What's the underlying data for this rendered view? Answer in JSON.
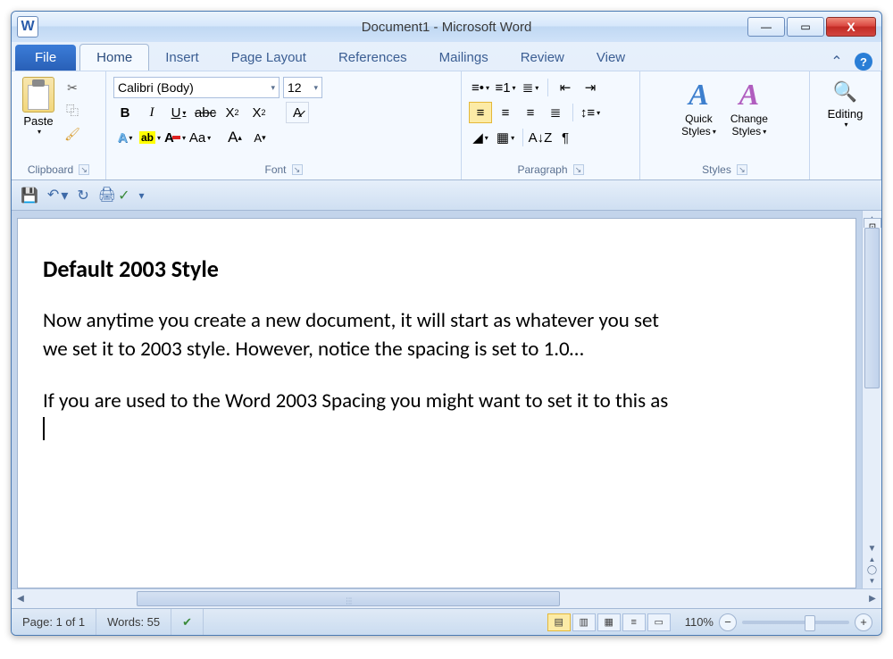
{
  "window": {
    "title": "Document1  -  Microsoft Word",
    "app_icon_letter": "W"
  },
  "tabs": {
    "file": "File",
    "items": [
      "Home",
      "Insert",
      "Page Layout",
      "References",
      "Mailings",
      "Review",
      "View"
    ],
    "active": "Home"
  },
  "clipboard": {
    "paste": "Paste",
    "group": "Clipboard"
  },
  "font": {
    "name": "Calibri (Body)",
    "size": "12",
    "group": "Font",
    "bold": "B",
    "italic": "I",
    "underline": "U",
    "strike": "abc",
    "sub": "X₂",
    "sup": "X²",
    "clearfmt": "Aᵃ",
    "textfx": "A",
    "highlight": "ab",
    "fontcolor": "A",
    "case": "Aa",
    "grow": "A",
    "shrink": "A"
  },
  "paragraph": {
    "group": "Paragraph"
  },
  "styles": {
    "quick": "Quick",
    "quick2": "Styles",
    "change": "Change",
    "change2": "Styles",
    "group": "Styles"
  },
  "editing": {
    "label": "Editing"
  },
  "document": {
    "heading": "Default 2003 Style",
    "p1": "Now anytime you create a new document, it will start as whatever you set",
    "p2": "we set it to 2003 style. However, notice the spacing is set to 1.0…",
    "p3": "If you are used to the Word 2003 Spacing you might want to set it to this as"
  },
  "status": {
    "page": "Page: 1 of 1",
    "words": "Words: 55",
    "zoom": "110%"
  }
}
